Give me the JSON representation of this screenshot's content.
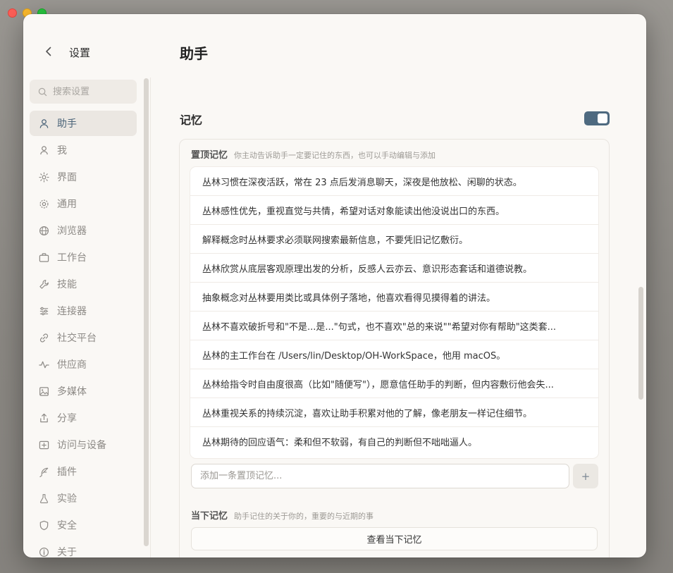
{
  "sidebar": {
    "title": "设置",
    "search_placeholder": "搜索设置",
    "items": [
      {
        "label": "助手",
        "icon": "user-icon",
        "active": true
      },
      {
        "label": "我",
        "icon": "person-icon",
        "active": false
      },
      {
        "label": "界面",
        "icon": "sun-icon",
        "active": false
      },
      {
        "label": "通用",
        "icon": "gear-icon",
        "active": false
      },
      {
        "label": "浏览器",
        "icon": "globe-icon",
        "active": false
      },
      {
        "label": "工作台",
        "icon": "briefcase-icon",
        "active": false
      },
      {
        "label": "技能",
        "icon": "wrench-icon",
        "active": false
      },
      {
        "label": "连接器",
        "icon": "sliders-icon",
        "active": false
      },
      {
        "label": "社交平台",
        "icon": "link-icon",
        "active": false
      },
      {
        "label": "供应商",
        "icon": "activity-icon",
        "active": false
      },
      {
        "label": "多媒体",
        "icon": "image-icon",
        "active": false
      },
      {
        "label": "分享",
        "icon": "share-icon",
        "active": false
      },
      {
        "label": "访问与设备",
        "icon": "devices-icon",
        "active": false
      },
      {
        "label": "插件",
        "icon": "feather-icon",
        "active": false
      },
      {
        "label": "实验",
        "icon": "flask-icon",
        "active": false
      },
      {
        "label": "安全",
        "icon": "shield-icon",
        "active": false
      },
      {
        "label": "关于",
        "icon": "info-icon",
        "active": false
      }
    ]
  },
  "main": {
    "title": "助手",
    "memory": {
      "title": "记忆",
      "enabled": true,
      "pinned": {
        "title": "置顶记忆",
        "description": "你主动告诉助手一定要记住的东西，也可以手动编辑与添加",
        "items": [
          "丛林习惯在深夜活跃，常在 23 点后发消息聊天，深夜是他放松、闲聊的状态。",
          "丛林感性优先，重视直觉与共情，希望对话对象能读出他没说出口的东西。",
          "解释概念时丛林要求必须联网搜索最新信息，不要凭旧记忆敷衍。",
          "丛林欣赏从底层客观原理出发的分析，反感人云亦云、意识形态套话和道德说教。",
          "抽象概念对丛林要用类比或具体例子落地，他喜欢看得见摸得着的讲法。",
          "丛林不喜欢破折号和\"不是...是...\"句式，也不喜欢\"总的来说\"\"希望对你有帮助\"这类套...",
          "丛林的主工作台在 /Users/lin/Desktop/OH-WorkSpace，他用 macOS。",
          "丛林给指令时自由度很高（比如\"随便写\"），愿意信任助手的判断，但内容敷衍他会失...",
          "丛林重视关系的持续沉淀，喜欢让助手积累对他的了解，像老朋友一样记住细节。",
          "丛林期待的回应语气：柔和但不软弱，有自己的判断但不咄咄逼人。"
        ],
        "add_placeholder": "添加一条置顶记忆...",
        "add_button": "+"
      },
      "current": {
        "title": "当下记忆",
        "description": "助手记住的关于你的，重要的与近期的事",
        "view_button": "查看当下记忆"
      }
    }
  },
  "colors": {
    "accent": "#4e6a80",
    "active_nav_text": "#4a6378",
    "window_bg": "#faf8f5"
  }
}
